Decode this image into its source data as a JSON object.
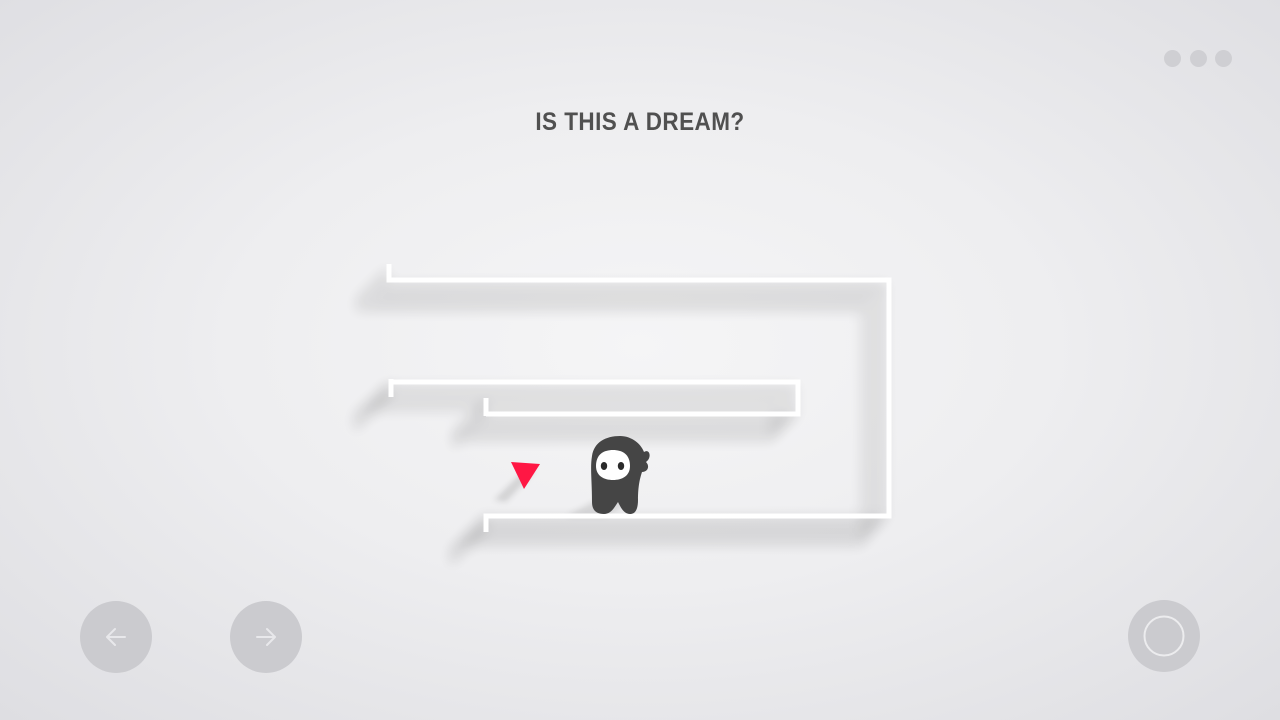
{
  "level": {
    "title": "IS THIS A DREAM?"
  },
  "controls": {
    "menu_icon": "three-dots-icon",
    "left_icon": "arrow-left-icon",
    "right_icon": "arrow-right-icon",
    "action_icon": "ring-icon"
  },
  "colors": {
    "background": "#eeeef0",
    "wall": "#ffffff",
    "character": "#454545",
    "goal": "#ff1744",
    "button": "#cbcbcf",
    "title": "#505050"
  }
}
